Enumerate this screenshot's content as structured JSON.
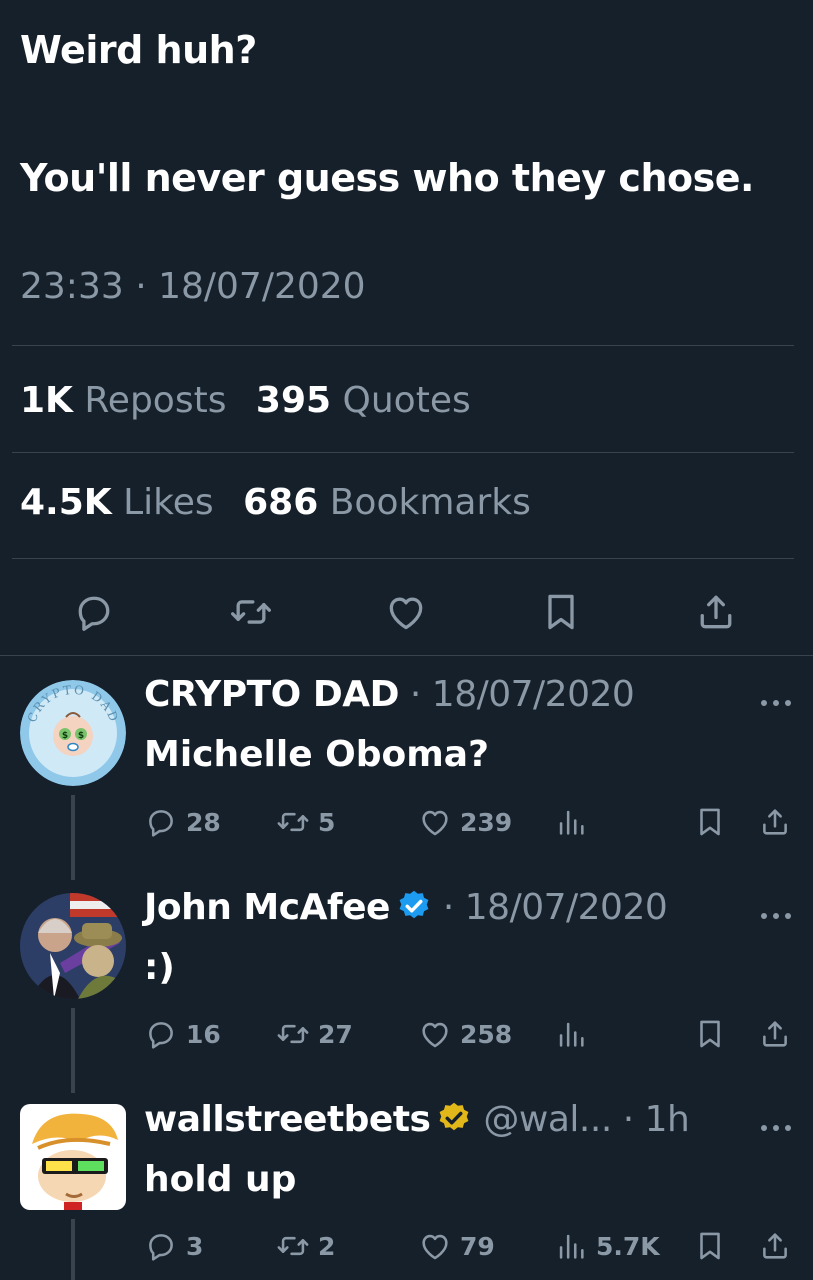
{
  "tweet": {
    "line1": "Weird huh?",
    "line2": "You'll never guess who they chose.",
    "timestamp": "23:33 · 18/07/2020",
    "reposts_count": "1K",
    "reposts_label": "Reposts",
    "quotes_count": "395",
    "quotes_label": "Quotes",
    "likes_count": "4.5K",
    "likes_label": "Likes",
    "bookmarks_count": "686",
    "bookmarks_label": "Bookmarks"
  },
  "actions": [
    "reply-icon",
    "repost-icon",
    "like-icon",
    "bookmark-icon",
    "share-icon"
  ],
  "colors": {
    "background": "#15202b",
    "text": "#ffffff",
    "muted": "#8b98a5",
    "divider": "#38444d",
    "verified_blue": "#1d9bf0",
    "verified_gold": "#e2b719"
  },
  "replies": [
    {
      "name": "CRYPTO DAD",
      "meta": " · 18/07/2020",
      "text": "Michelle Oboma?",
      "avatar_text": "CRYPTO DAD",
      "counts": {
        "reply": "28",
        "repost": "5",
        "like": "239",
        "views": ""
      }
    },
    {
      "name": "John McAfee",
      "meta": " · 18/07/2020",
      "text": ":)",
      "badge": "blue",
      "counts": {
        "reply": "16",
        "repost": "27",
        "like": "258",
        "views": ""
      }
    },
    {
      "name": "wallstreetbets",
      "meta": " @wal... · 1h",
      "text": "hold up",
      "badge": "gold",
      "counts": {
        "reply": "3",
        "repost": "2",
        "like": "79",
        "views": "5.7K"
      }
    }
  ]
}
